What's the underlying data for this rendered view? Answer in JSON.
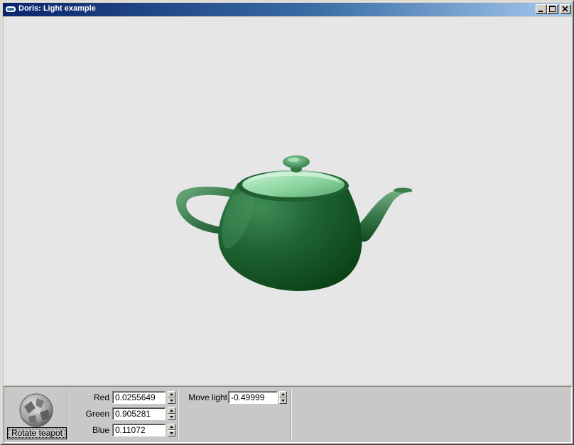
{
  "window": {
    "title": "Doris: Light example",
    "controls": {
      "minimize": "minimize-icon",
      "maximize": "maximize-icon",
      "close": "close-icon"
    }
  },
  "viewport": {
    "background": "#e6e6e6",
    "object": "teapot",
    "object_color": "#0b4a1a"
  },
  "panel": {
    "rotate_button_label": "Rotate teapot",
    "fields": {
      "red": {
        "label": "Red",
        "value": "0.0255649"
      },
      "green": {
        "label": "Green",
        "value": "0.905281"
      },
      "blue": {
        "label": "Blue",
        "value": "0.11072"
      },
      "move_light": {
        "label": "Move light",
        "value": "-0.49999"
      }
    }
  }
}
